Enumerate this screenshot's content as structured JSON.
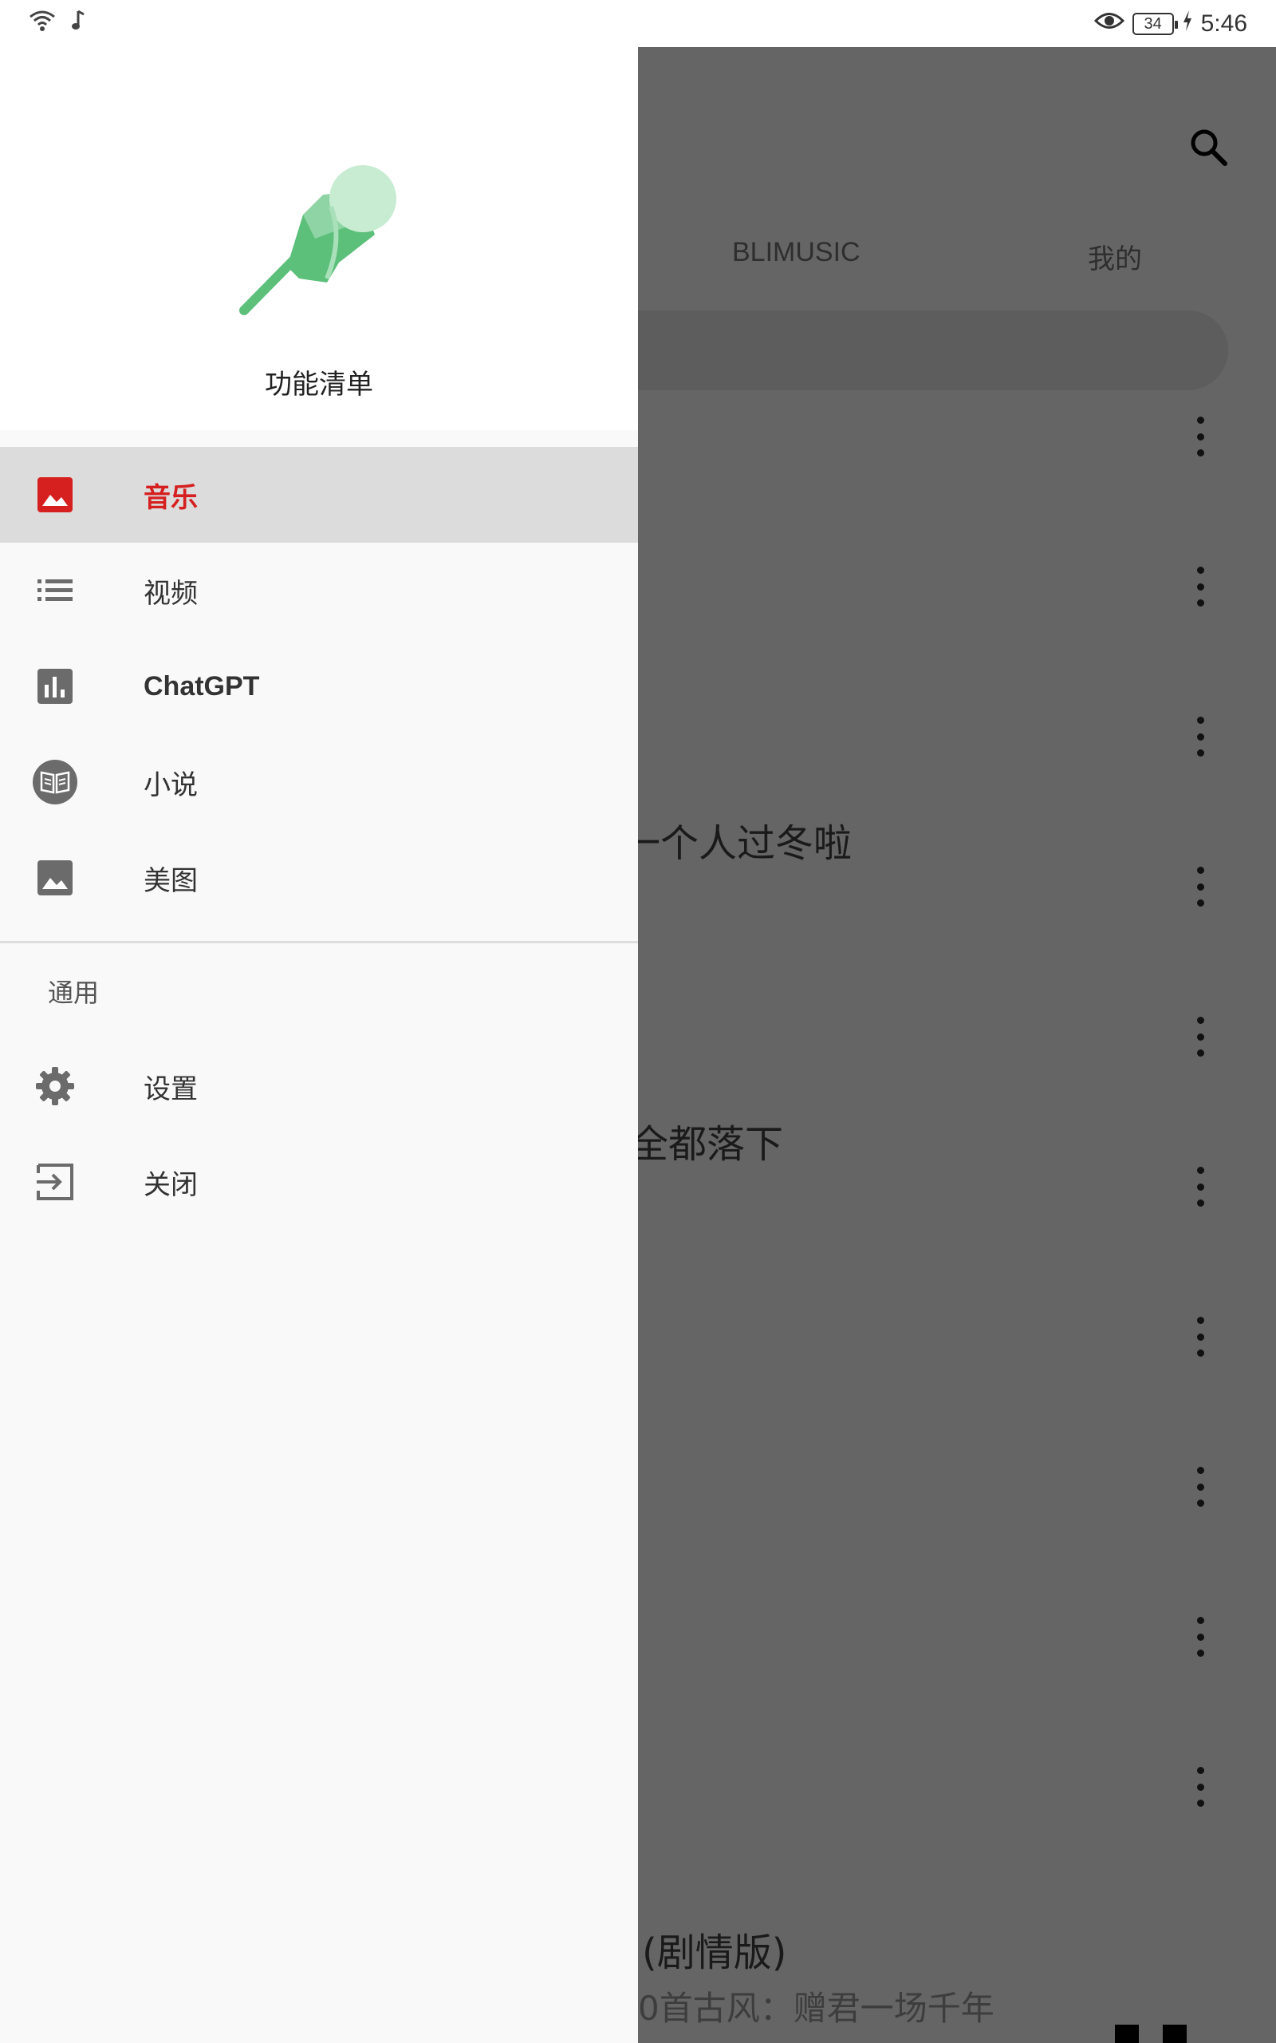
{
  "status_bar": {
    "time": "5:46",
    "battery": "34",
    "icons": [
      "wifi-icon",
      "music-note-icon",
      "eye-icon",
      "battery-icon",
      "charging-icon"
    ]
  },
  "background": {
    "tabs": [
      "BLIMUSIC",
      "我的"
    ],
    "songs": [
      "一个人过冬啦",
      "全都落下",
      "(剧情版)"
    ],
    "now_playing_sub": "0首古风：赠君一场千年"
  },
  "drawer": {
    "header_title": "功能清单",
    "items": [
      {
        "label": "音乐",
        "icon": "image-icon",
        "active": true
      },
      {
        "label": "视频",
        "icon": "list-icon",
        "active": false
      },
      {
        "label": "ChatGPT",
        "icon": "bar-chart-icon",
        "active": false
      },
      {
        "label": "小说",
        "icon": "book-icon",
        "active": false
      },
      {
        "label": "美图",
        "icon": "image-icon",
        "active": false
      }
    ],
    "section_title": "通用",
    "general_items": [
      {
        "label": "设置",
        "icon": "gear-icon"
      },
      {
        "label": "关闭",
        "icon": "exit-icon"
      }
    ]
  },
  "colors": {
    "accent": "#d62020",
    "icon_gray": "#6b6b6b",
    "scrim": "#656565",
    "logo_green": "#5cbf7a"
  }
}
